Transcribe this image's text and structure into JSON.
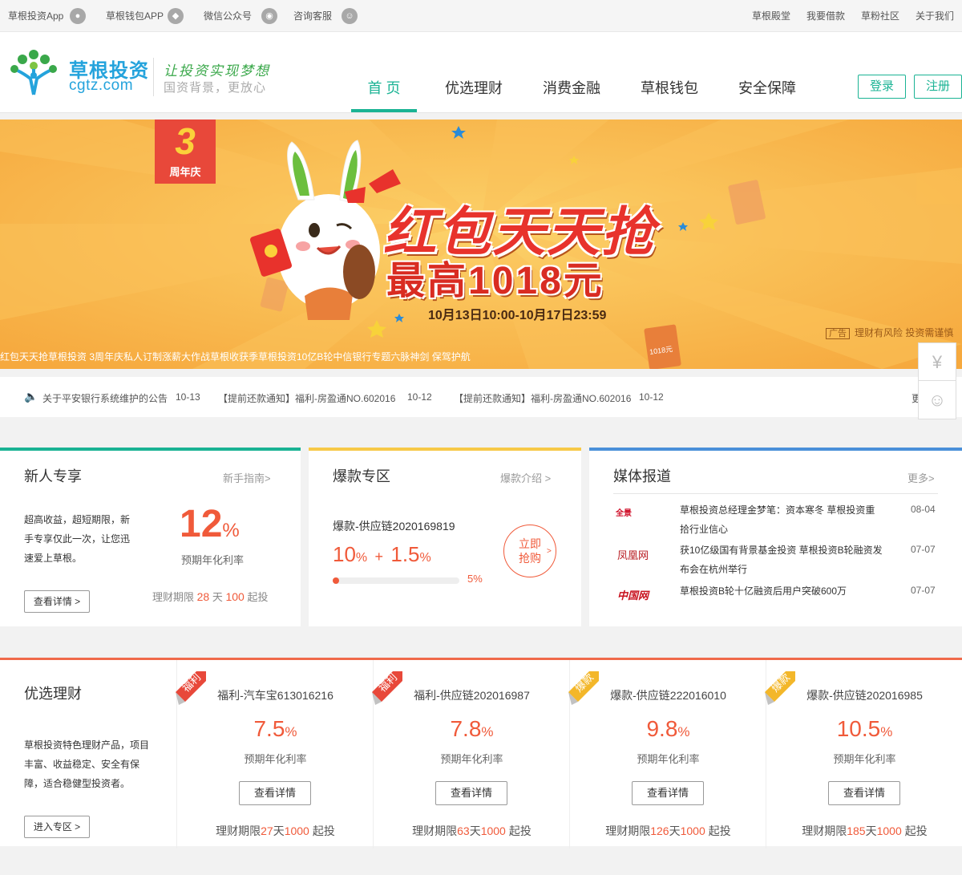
{
  "topbar": {
    "left": [
      {
        "label": "草根投资App",
        "icon": "android-icon"
      },
      {
        "label": "草根钱包APP",
        "icon": "wallet-app-icon"
      },
      {
        "label": "微信公众号",
        "icon": "wechat-icon"
      },
      {
        "label": "咨询客服",
        "icon": "support-icon"
      }
    ],
    "right": [
      "草根殿堂",
      "我要借款",
      "草粉社区",
      "关于我们"
    ]
  },
  "header": {
    "logo_cn": "草根投资",
    "logo_en": "cgtz.com",
    "slogan": "让投资实现梦想",
    "slogan2": "国资背景，更放心",
    "nav": [
      "首 页",
      "优选理财",
      "消费金融",
      "草根钱包",
      "安全保障"
    ],
    "login": "登录",
    "register": "注册"
  },
  "banner": {
    "badge_num": "3",
    "badge_text": "周年庆",
    "title": "红包天天抢",
    "subtitle": "最高1018元",
    "date": "10月13日10:00-10月17日23:59",
    "ad_tag": "广告",
    "ad_text": "理财有风险  投资需谨慎",
    "marquee": "红包天天抢草根投资 3周年庆私人订制涨薪大作战草根收获季草根投资10亿B轮中信银行专题六脉神剑 保驾护航",
    "coin_text": "1018元"
  },
  "notice": {
    "items": [
      {
        "text": "关于平安银行系统维护的公告",
        "date": "10-13"
      },
      {
        "text": "【提前还款通知】福利-房盈通NO.602016",
        "date": "10-12"
      },
      {
        "text": "【提前还款通知】福利-房盈通NO.602016",
        "date": "10-12"
      }
    ],
    "more": "更"
  },
  "newbie": {
    "title": "新人专享",
    "more": "新手指南>",
    "desc": [
      "超高收益，超短期限，新",
      "手专享仅此一次，让您迅",
      "速爱上草根。"
    ],
    "rate": "12",
    "rate_unit": "%",
    "rate_label": "预期年化利率",
    "btn": "查看详情 >",
    "term_prefix": "理财期限",
    "term_days": "28",
    "term_day_unit": "天",
    "term_min": "100",
    "term_suffix": "起投"
  },
  "hot": {
    "title": "爆款专区",
    "more": "爆款介绍 >",
    "product": "爆款-供应链2020169819",
    "rate_base": "10",
    "rate_plus": "1.5",
    "progress_pct": "5%",
    "progress": 0.05,
    "buy": [
      "立即",
      "抢购"
    ]
  },
  "media": {
    "title": "媒体报道",
    "more": "更多>",
    "items": [
      {
        "logo": "全景",
        "lines": [
          "草根投资总经理金梦笔：资本寒冬 草根投资重",
          "拾行业信心"
        ],
        "date": "08-04"
      },
      {
        "logo": "凤凰网",
        "lines": [
          "获10亿级国有背景基金投资 草根投资B轮融资发",
          "布会在杭州举行"
        ],
        "date": "07-07"
      },
      {
        "logo": "中国网",
        "lines": [
          "草根投资B轮十亿融资后用户突破600万"
        ],
        "date": "07-07"
      }
    ]
  },
  "products": {
    "title": "优选理财",
    "desc": [
      "草根投资特色理财产品，项目",
      "丰富、收益稳定、安全有保",
      "障，适合稳健型投资者。"
    ],
    "enter": "进入专区 >",
    "rate_label": "预期年化利率",
    "btn": "查看详情",
    "term_prefix": "理财期限",
    "day_unit": "天",
    "suffix": "起投",
    "items": [
      {
        "tag": "福利",
        "tag_color": "#e8483a",
        "name": "福利-汽车宝613016216",
        "rate": "7.5",
        "days": "27",
        "min": "1000"
      },
      {
        "tag": "福利",
        "tag_color": "#e8483a",
        "name": "福利-供应链202016987",
        "rate": "7.8",
        "days": "63",
        "min": "1000"
      },
      {
        "tag": "爆款",
        "tag_color": "#f3b72a",
        "name": "爆款-供应链222016010",
        "rate": "9.8",
        "days": "126",
        "min": "1000"
      },
      {
        "tag": "爆款",
        "tag_color": "#f3b72a",
        "name": "爆款-供应链202016985",
        "rate": "10.5",
        "days": "185",
        "min": "1000"
      }
    ]
  },
  "colors": {
    "brand": "#1ab394",
    "accent": "#f05a3a",
    "newbie_bar": "#1ab394",
    "hot_bar": "#f7c948",
    "media_bar": "#4a90d9"
  }
}
